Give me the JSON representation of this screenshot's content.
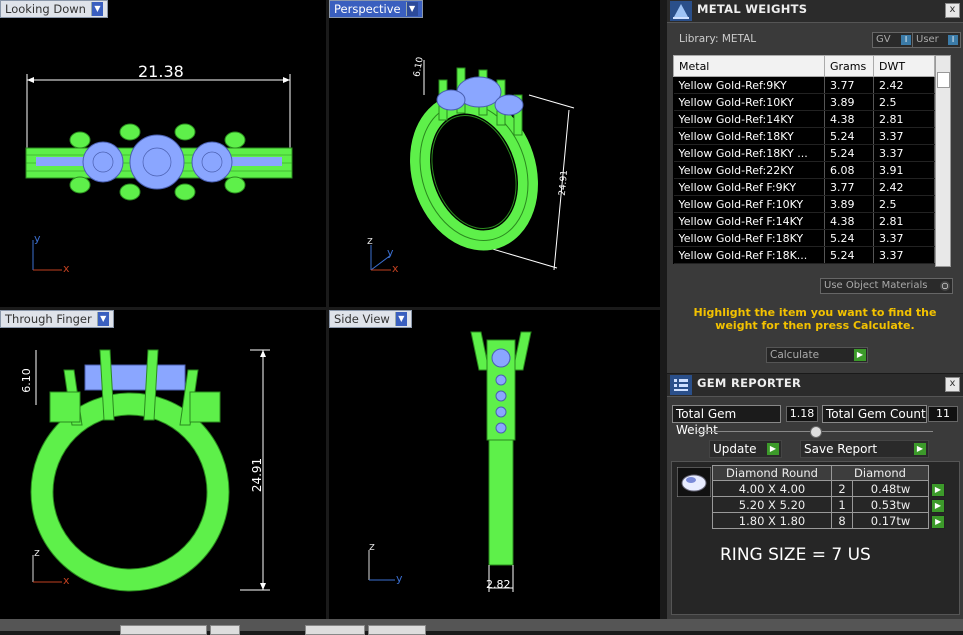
{
  "viewports": {
    "top_left": {
      "label": "Looking Down",
      "dimension": "21.38",
      "axis_x": "x",
      "axis_y": "y"
    },
    "top_right": {
      "label": "Perspective",
      "dim_a": "6.10",
      "dim_b": "24.91",
      "axis_x": "x",
      "axis_y": "y",
      "axis_z": "z"
    },
    "bottom_left": {
      "label": "Through Finger",
      "dim_height": "6.10",
      "dim_total": "24.91",
      "axis_x": "x",
      "axis_z": "z"
    },
    "bottom_right": {
      "label": "Side View",
      "dimension": "2.82",
      "axis_y": "y",
      "axis_z": "z"
    }
  },
  "metal_weights": {
    "title": "METAL WEIGHTS",
    "close": "x",
    "library_label": "Library: METAL",
    "toggle_gv": "GV",
    "toggle_user": "User",
    "columns": [
      "Metal",
      "Grams",
      "DWT"
    ],
    "rows": [
      [
        "Yellow Gold-Ref:9KY",
        "3.77",
        "2.42"
      ],
      [
        "Yellow Gold-Ref:10KY",
        "3.89",
        "2.5"
      ],
      [
        "Yellow Gold-Ref:14KY",
        "4.38",
        "2.81"
      ],
      [
        "Yellow Gold-Ref:18KY",
        "5.24",
        "3.37"
      ],
      [
        "Yellow Gold-Ref:18KY ...",
        "5.24",
        "3.37"
      ],
      [
        "Yellow Gold-Ref:22KY",
        "6.08",
        "3.91"
      ],
      [
        "Yellow Gold-Ref F:9KY",
        "3.77",
        "2.42"
      ],
      [
        "Yellow Gold-Ref F:10KY",
        "3.89",
        "2.5"
      ],
      [
        "Yellow Gold-Ref F:14KY",
        "4.38",
        "2.81"
      ],
      [
        "Yellow Gold-Ref F:18KY",
        "5.24",
        "3.37"
      ],
      [
        "Yellow Gold-Ref F:18K...",
        "5.24",
        "3.37"
      ]
    ],
    "use_object_materials": "Use Object Materials",
    "instruction": "Highlight the item you want to find the weight for then press Calculate.",
    "calculate": "Calculate"
  },
  "gem_reporter": {
    "title": "GEM REPORTER",
    "close": "x",
    "total_gem_weight_label": "Total Gem Weight",
    "total_gem_weight": "1.18",
    "total_gem_count_label": "Total Gem Count",
    "total_gem_count": "11",
    "update": "Update",
    "save_report": "Save Report",
    "shape": "Diamond Round",
    "material": "Diamond",
    "gems": [
      {
        "size": "4.00 X 4.00",
        "count": "2",
        "weight": "0.48tw"
      },
      {
        "size": "5.20 X 5.20",
        "count": "1",
        "weight": "0.53tw"
      },
      {
        "size": "1.80 X 1.80",
        "count": "8",
        "weight": "0.17tw"
      }
    ],
    "ring_size": "RING SIZE = 7 US"
  },
  "colors": {
    "wire_green": "#5ef04a",
    "gem_blue": "#8aa6ff",
    "highlight_yellow": "#f3c200",
    "go_green": "#3c9a2a"
  }
}
